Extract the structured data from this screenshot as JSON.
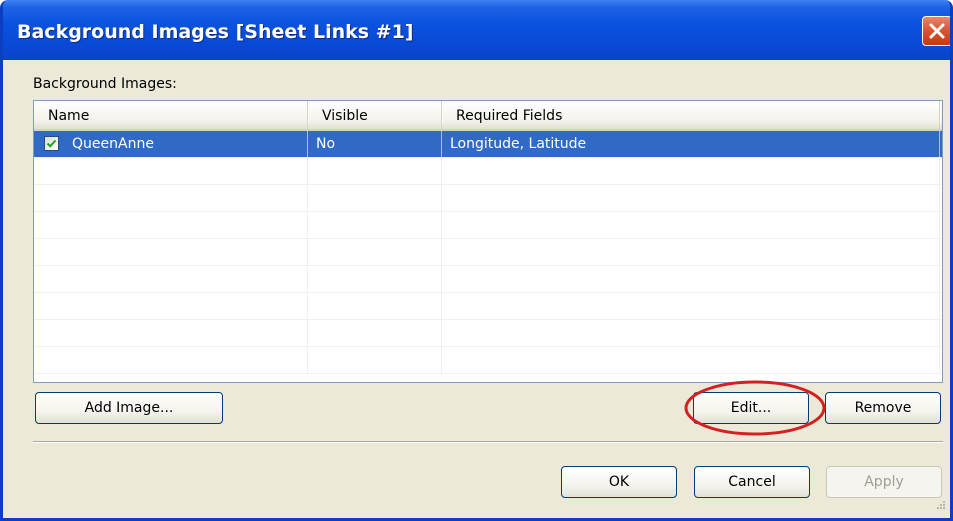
{
  "window": {
    "title": "Background Images [Sheet Links #1]"
  },
  "list": {
    "label": "Background Images:",
    "columns": [
      "Name",
      "Visible",
      "Required Fields"
    ],
    "rows": [
      {
        "name": "QueenAnne",
        "visible": "No",
        "required_fields": "Longitude, Latitude",
        "checked": true,
        "selected": true
      }
    ]
  },
  "buttons": {
    "add_image": "Add Image...",
    "edit": "Edit...",
    "remove": "Remove",
    "ok": "OK",
    "cancel": "Cancel",
    "apply": "Apply"
  },
  "colors": {
    "titlebar": "#0a52de",
    "selection": "#316ac5",
    "highlight_oval": "#d42020"
  },
  "icons": {
    "close": "close-icon",
    "check": "checkmark-icon",
    "grip": "resize-grip-icon"
  }
}
